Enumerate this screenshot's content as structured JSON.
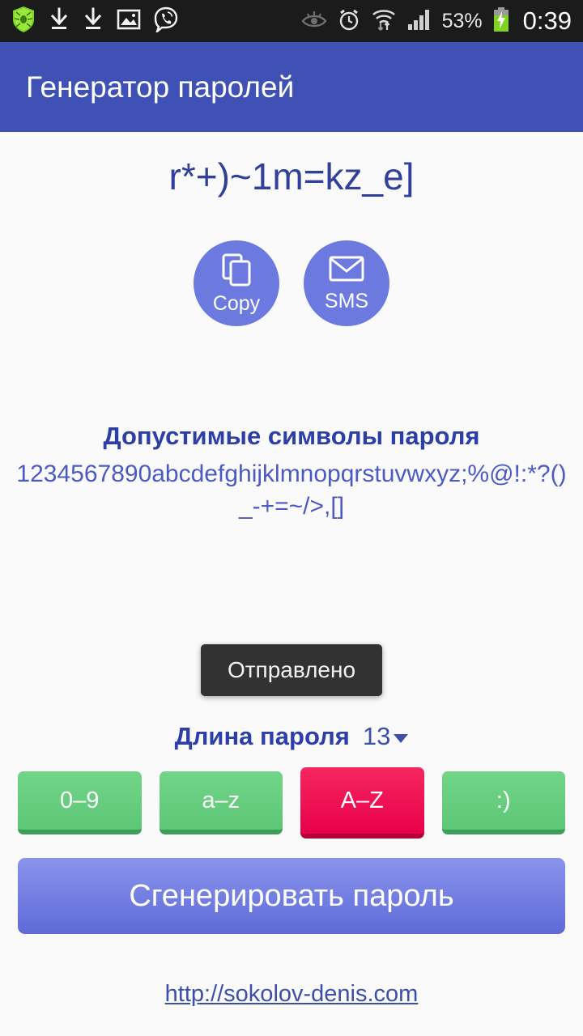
{
  "statusbar": {
    "left_icons": [
      "shield-antivirus-icon",
      "download-icon",
      "download-icon",
      "gallery-image-icon",
      "viber-call-icon"
    ],
    "right_icons": [
      "eye-off-icon",
      "alarm-clock-icon",
      "wifi-transfer-icon",
      "signal-bars-icon"
    ],
    "battery_percent": "53%",
    "battery_state": "charging",
    "clock": "0:39"
  },
  "appbar": {
    "title": "Генератор паролей",
    "color": "#3f51b5"
  },
  "main": {
    "generated_password": "r*+)~1m=kz_e]",
    "actions": [
      {
        "label": "Copy",
        "icon": "copy-icon"
      },
      {
        "label": "SMS",
        "icon": "envelope-icon"
      }
    ],
    "charset_title": "Допустимые символы пароля",
    "charset_value": "1234567890abcdefghijklmnopqrstuvwxyz;%@!:*?()_-+=~/>,[]",
    "toast_message": "Отправлено",
    "length_label": "Длина пароля",
    "length_value": "13",
    "toggles": [
      {
        "label": "0–9",
        "enabled": true
      },
      {
        "label": "a–z",
        "enabled": true
      },
      {
        "label": "A–Z",
        "enabled": false
      },
      {
        "label": ":)",
        "enabled": true
      }
    ],
    "generate_label": "Сгенерировать пароль",
    "footer_link": "http://sokolov-denis.com"
  },
  "colors": {
    "accent_blue": "#3f51b5",
    "circle_button": "#6c7ae0",
    "text_blue": "#31409a",
    "toggle_on": "#5dc777",
    "toggle_off": "#e8004a",
    "background": "#fafafa"
  }
}
